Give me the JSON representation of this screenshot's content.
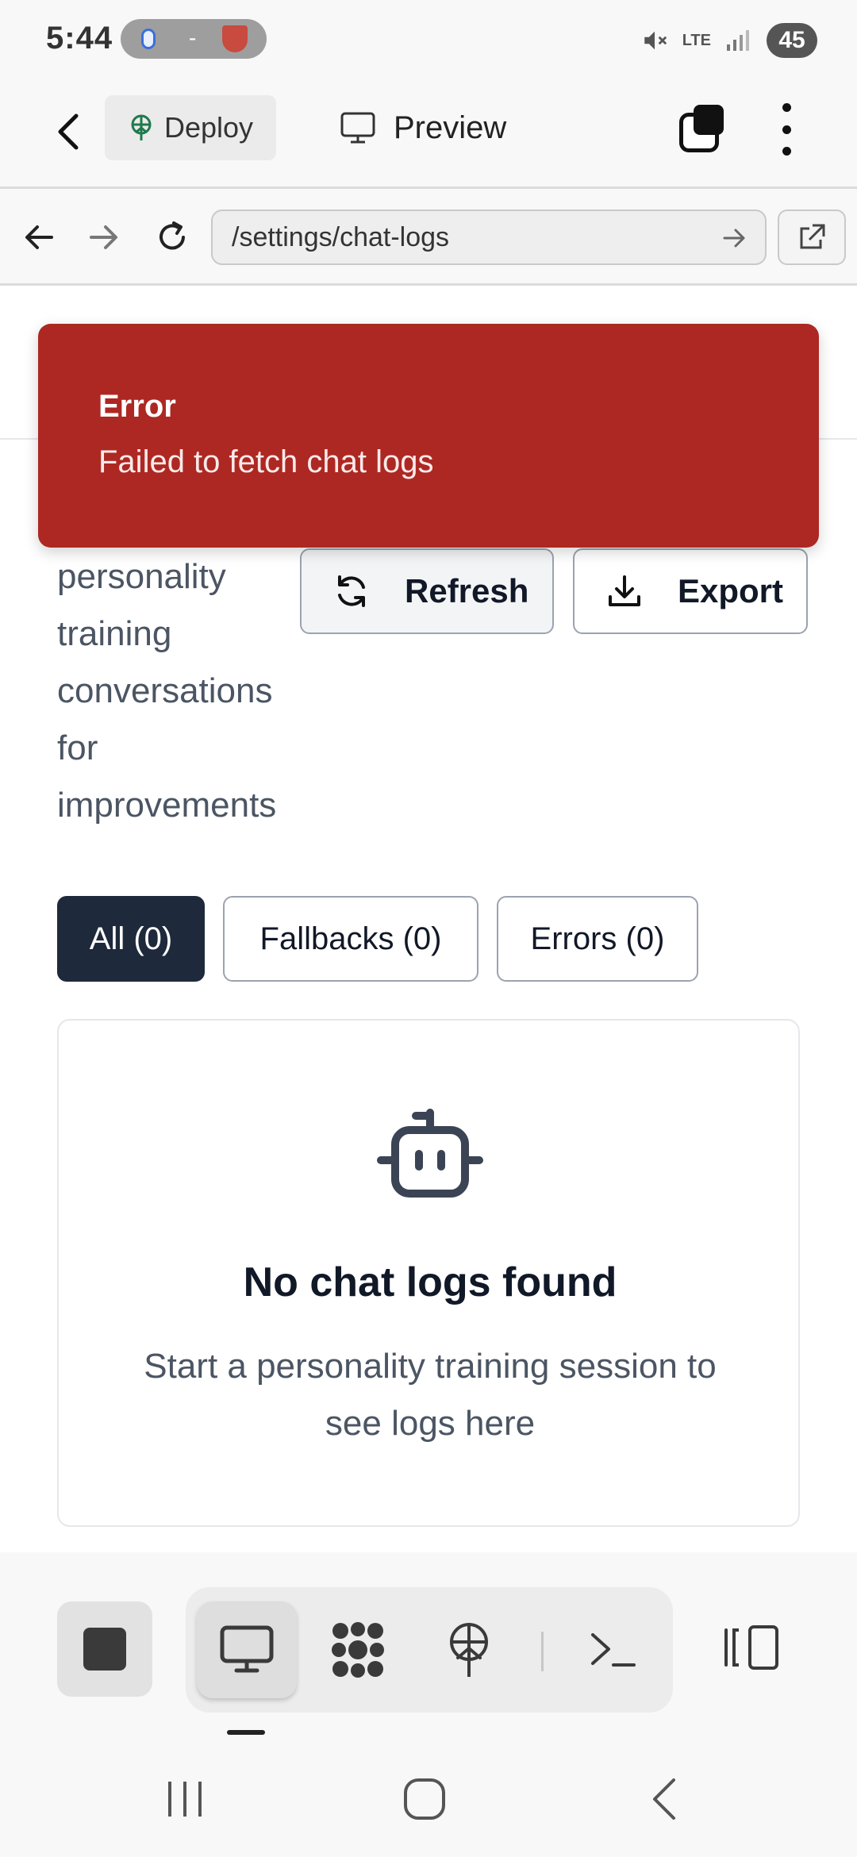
{
  "status_bar": {
    "time": "5:44",
    "pill_separator": "-",
    "network": "LTE",
    "battery": "45"
  },
  "app_bar": {
    "deploy_label": "Deploy",
    "preview_label": "Preview"
  },
  "browser": {
    "url": "/settings/chat-logs"
  },
  "toast": {
    "title": "Error",
    "message": "Failed to fetch chat logs",
    "color": "#ad2822"
  },
  "page": {
    "description": "personality training conversations for improvements",
    "refresh_label": "Refresh",
    "export_label": "Export",
    "filters": [
      {
        "label": "All (0)",
        "active": true
      },
      {
        "label": "Fallbacks (0)",
        "active": false
      },
      {
        "label": "Errors (0)",
        "active": false
      }
    ],
    "empty_state": {
      "icon": "bot-icon",
      "title": "No chat logs found",
      "subtitle": "Start a personality training session to see logs here"
    }
  },
  "toolbar": {
    "tools": [
      "monitor-icon",
      "cluster-icon",
      "deploy-icon",
      "terminal-icon"
    ],
    "active_tool": "monitor-icon"
  },
  "colors": {
    "accent_dark": "#1e293b",
    "error": "#ad2822"
  }
}
